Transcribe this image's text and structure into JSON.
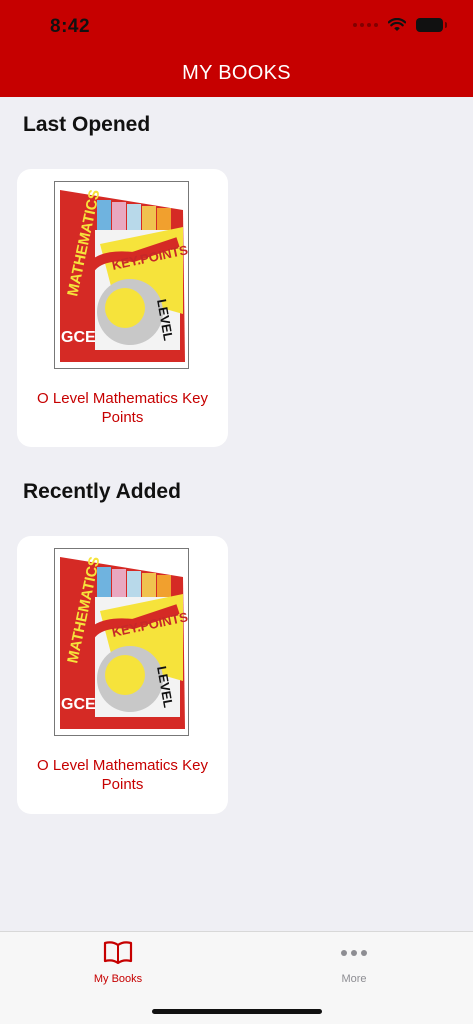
{
  "status_bar": {
    "time": "8:42"
  },
  "header": {
    "title": "MY BOOKS"
  },
  "sections": [
    {
      "title": "Last Opened",
      "book": {
        "title": "O Level Mathematics Key Points"
      }
    },
    {
      "title": "Recently Added",
      "book": {
        "title": "O Level Mathematics Key Points"
      }
    }
  ],
  "tabbar": {
    "items": [
      {
        "label": "My Books",
        "icon": "book-icon",
        "active": true
      },
      {
        "label": "More",
        "icon": "more-icon",
        "active": false
      }
    ]
  },
  "colors": {
    "brand": "#c60000",
    "background": "#efeff4",
    "inactive_tab": "#8e8e93"
  }
}
